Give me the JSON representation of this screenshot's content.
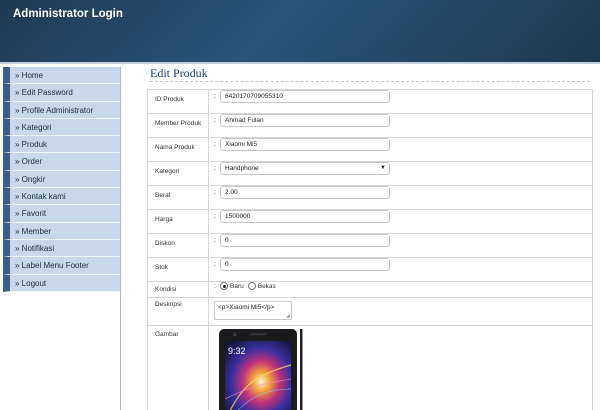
{
  "header": {
    "title": "Administrator Login"
  },
  "sidebar": {
    "items": [
      {
        "label": "» Home"
      },
      {
        "label": "» Edit Password"
      },
      {
        "label": "» Profile Administrator"
      },
      {
        "label": "» Kategori"
      },
      {
        "label": "» Produk"
      },
      {
        "label": "» Order"
      },
      {
        "label": "» Ongkir"
      },
      {
        "label": "» Kontak kami"
      },
      {
        "label": "» Favorit"
      },
      {
        "label": "» Member"
      },
      {
        "label": "» Notifikasi"
      },
      {
        "label": "» Label Menu Footer"
      },
      {
        "label": "» Logout"
      }
    ]
  },
  "main": {
    "title": "Edit Produk",
    "form": {
      "colon": ":",
      "id_produk": {
        "label": "ID Produk",
        "value": "6420170709055310"
      },
      "member_produk": {
        "label": "Member Produk",
        "value": "Ahmad Fulan"
      },
      "nama_produk": {
        "label": "Nama Produk",
        "value": "Xiaomi Mi5"
      },
      "kategori": {
        "label": "Kategori",
        "value": "Handphone"
      },
      "berat": {
        "label": "Berat",
        "value": "2.00"
      },
      "harga": {
        "label": "Harga",
        "value": "1500000"
      },
      "diskon": {
        "label": "Diskon",
        "value": "0"
      },
      "stok": {
        "label": "Stok",
        "value": "0"
      },
      "kondisi": {
        "label": "Kondisi",
        "options": [
          "Baru",
          "Bekas"
        ],
        "selected": "Baru"
      },
      "deskripsi": {
        "label": "Deskripsi",
        "value": "<p>Xiaomi Mi5</p>"
      },
      "gambar": {
        "label": "Gambar"
      }
    }
  }
}
